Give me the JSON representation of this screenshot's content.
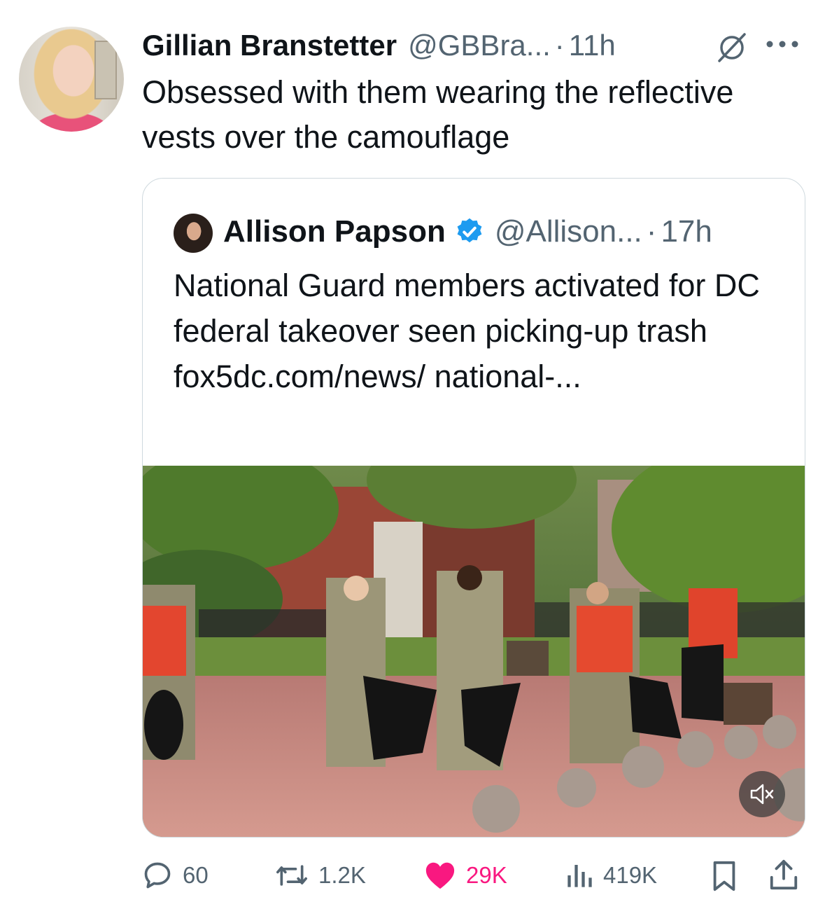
{
  "tweet": {
    "author_name": "Gillian Branstetter",
    "author_handle": "@GBBra...",
    "separator": "·",
    "time": "11h",
    "text": "Obsessed with them wearing the reflective vests over the camouflage"
  },
  "quoted_tweet": {
    "author_name": "Allison Papson",
    "author_handle": "@Allison...",
    "separator": "·",
    "time": "17h",
    "text": "National Guard members activated for DC federal takeover seen picking-up trash fox5dc.com/news/ national-..."
  },
  "actions": {
    "replies": "60",
    "reposts": "1.2K",
    "likes": "29K",
    "views": "419K"
  },
  "colors": {
    "like": "#f91880",
    "verified": "#1d9bf0",
    "muted_text": "#536471"
  }
}
